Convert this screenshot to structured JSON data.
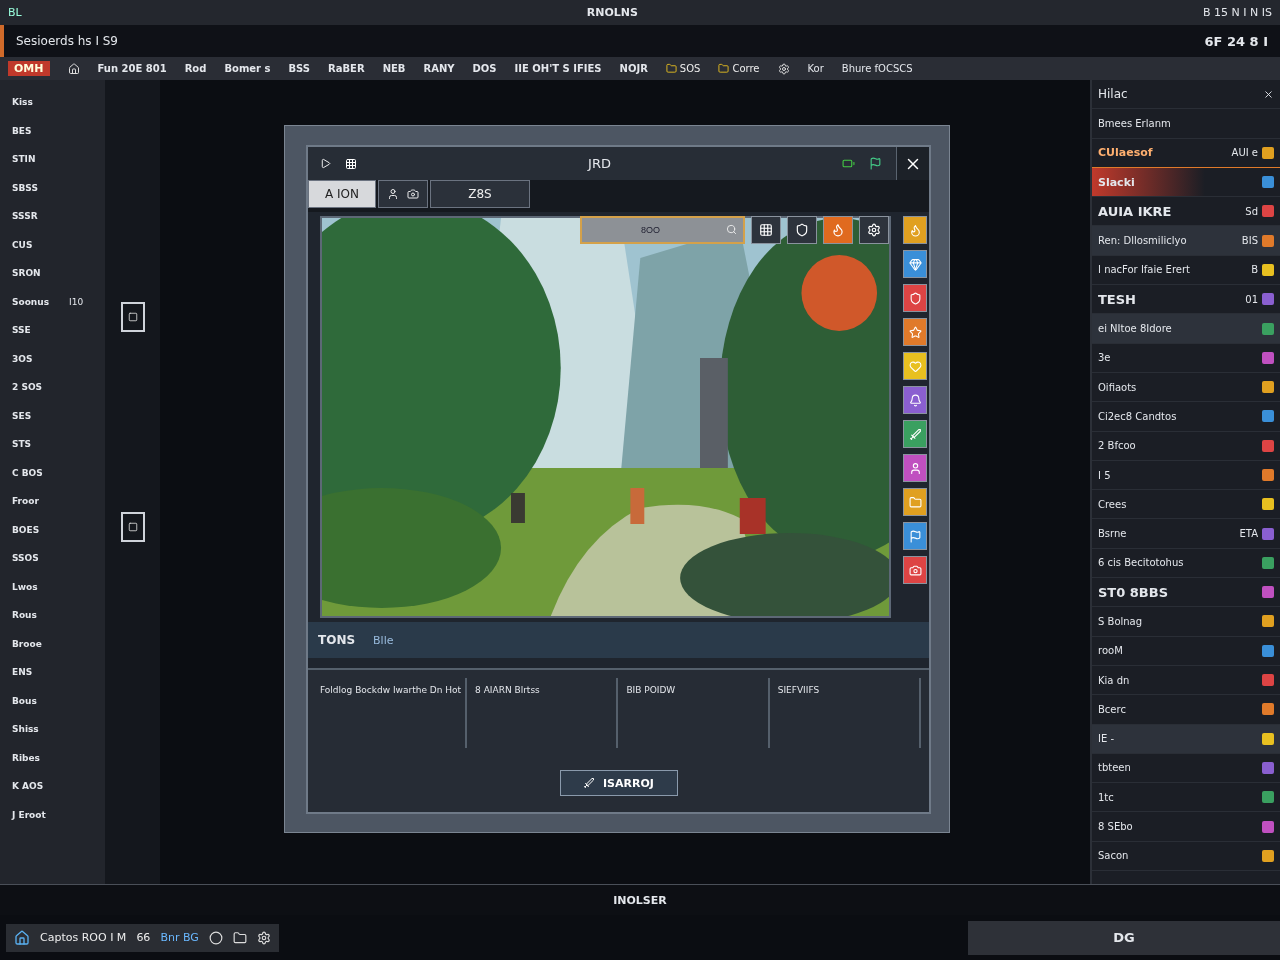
{
  "title_bar": {
    "left": "BL",
    "title": "RNOLNS",
    "right": "B 15 N I N IS"
  },
  "header": {
    "left": "Sesioerds hs I S9",
    "right": "6F 24 8 I"
  },
  "toolbar": {
    "badge": "OMH",
    "items": [
      "Fun 20E 801",
      "Rod",
      "Bomer s",
      "BSS",
      "RaBER",
      "NEB",
      "RANY",
      "DOS",
      "IIE OH'T S IFIES",
      "NOJR"
    ],
    "tags": [
      "SOS",
      "Corre"
    ],
    "right_items": [
      "Kor",
      "Bhure fOCSCS"
    ]
  },
  "sidebar": {
    "items": [
      {
        "label": "Kiss"
      },
      {
        "label": "BES"
      },
      {
        "label": "STIN"
      },
      {
        "label": "SBSS"
      },
      {
        "label": "SSSR"
      },
      {
        "label": "CUS"
      },
      {
        "label": "SRON"
      },
      {
        "label": "Soonus",
        "value": "I10"
      },
      {
        "label": "SSE"
      },
      {
        "label": "3OS"
      },
      {
        "label": "2 SOS"
      },
      {
        "label": "SES"
      },
      {
        "label": "STS"
      },
      {
        "label": "C BOS"
      },
      {
        "label": "Froor"
      },
      {
        "label": "BOES"
      },
      {
        "label": "SSOS"
      },
      {
        "label": "Lwos"
      },
      {
        "label": "Rous"
      },
      {
        "label": "Brooe"
      },
      {
        "label": "ENS"
      },
      {
        "label": "Bous"
      },
      {
        "label": "Shiss"
      },
      {
        "label": "Ribes"
      },
      {
        "label": "K AOS"
      },
      {
        "label": "J Eroot"
      }
    ]
  },
  "dialog": {
    "title": "JRD",
    "tabs": [
      {
        "kind": "text",
        "label": "A ION",
        "selected": true
      },
      {
        "kind": "icons",
        "selected": false
      },
      {
        "kind": "text",
        "label": "Z8S",
        "selected": false
      }
    ],
    "search": {
      "value": "8OO"
    },
    "footer": {
      "title": "TONS",
      "subtitle": "Blle"
    },
    "columns": [
      "Foldlog Bockdw Iwarthe Dn Hot",
      "8 AIARN Blrtss",
      "BIB POIDW",
      "SIEFVIIFS"
    ],
    "button": "ISARROJ"
  },
  "right_panel": {
    "title": "Hilac",
    "subtitle": "Bmees Erlanm",
    "rows": [
      {
        "kind": "accent",
        "label": "CUlaesof",
        "value": "AUI e"
      },
      {
        "kind": "alert",
        "label": "Slacki"
      },
      {
        "kind": "heading",
        "label": "AUIA IKRE",
        "value": "Sd"
      },
      {
        "kind": "band",
        "label": "Ren: Dllosmiliclyo",
        "value": "BIS"
      },
      {
        "kind": "row",
        "label": "I nacFor Ifaie Erert",
        "value": "B"
      },
      {
        "kind": "heading",
        "label": "TESH",
        "value": "01"
      },
      {
        "kind": "band",
        "label": "ei NItoe 8Idore"
      },
      {
        "kind": "row",
        "label": "3e"
      },
      {
        "kind": "row",
        "label": "Oifiaots"
      },
      {
        "kind": "row",
        "label": "Ci2ec8 Candtos"
      },
      {
        "kind": "row",
        "label": "2 Bfcoo"
      },
      {
        "kind": "row",
        "label": "I 5"
      },
      {
        "kind": "row",
        "label": "Crees"
      },
      {
        "kind": "row",
        "label": "Bsrne",
        "value": "ETA"
      },
      {
        "kind": "row",
        "label": "6 cis Becitotohus"
      },
      {
        "kind": "heading",
        "label": "ST0 8BBS"
      },
      {
        "kind": "row",
        "label": "S Bolnag"
      },
      {
        "kind": "row",
        "label": "rooM"
      },
      {
        "kind": "row",
        "label": "Kia dn"
      },
      {
        "kind": "row",
        "label": "Bcerc"
      },
      {
        "kind": "band",
        "label": "IE -"
      },
      {
        "kind": "row",
        "label": "tbteen"
      },
      {
        "kind": "row",
        "label": "1tc"
      },
      {
        "kind": "row",
        "label": "8 SEbo"
      },
      {
        "kind": "row",
        "label": "Sacon"
      }
    ]
  },
  "status": "INOLSER",
  "taskbar": {
    "items": [
      "Captos ROO I M",
      "66",
      "Bnr BG"
    ],
    "right": "DG"
  }
}
